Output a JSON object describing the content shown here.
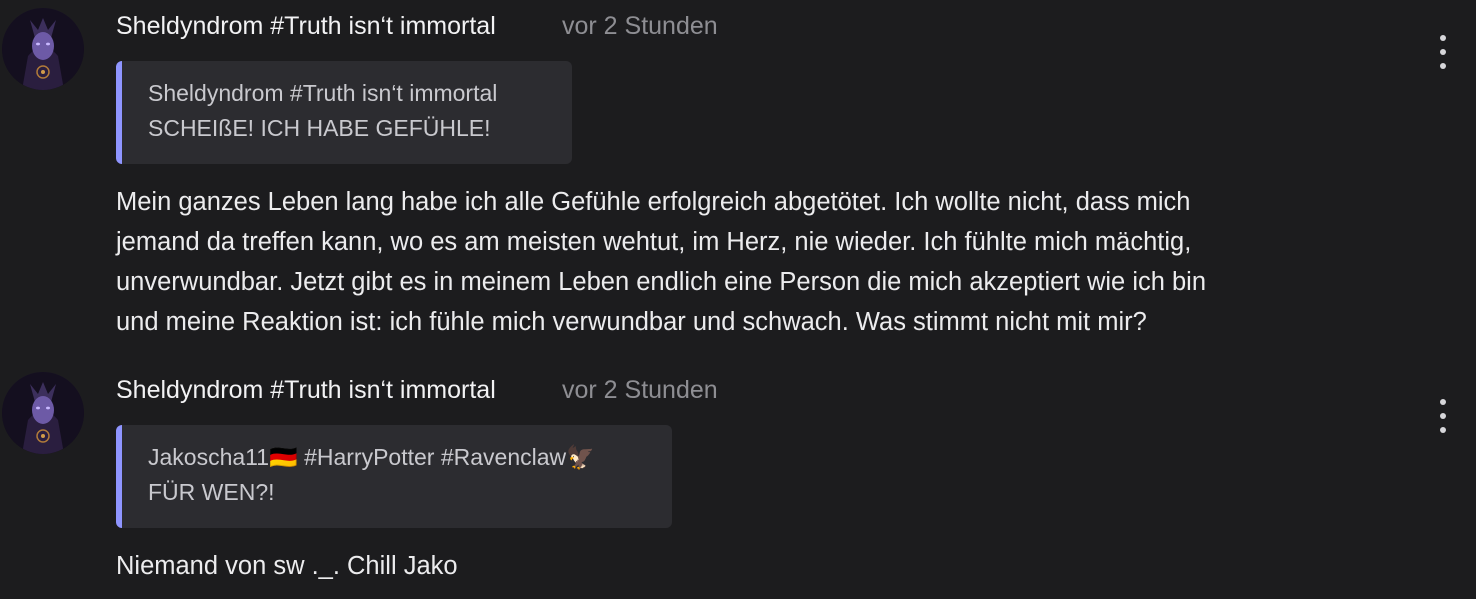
{
  "posts": [
    {
      "author": "Sheldyndrom #Truth isn‘t immortal",
      "time": "vor 2 Stunden",
      "quote": {
        "author": "Sheldyndrom #Truth isn‘t immortal",
        "text": "SCHEIßE! ICH HABE GEFÜHLE!"
      },
      "body": "Mein ganzes Leben lang habe ich alle Gefühle erfolgreich abgetötet. Ich wollte nicht, dass mich\njemand da treffen kann, wo es am meisten wehtut, im Herz, nie wieder. Ich fühlte mich mächtig,\nunverwundbar. Jetzt gibt es in meinem Leben endlich eine Person die mich akzeptiert wie ich bin\nund meine Reaktion ist: ich fühle mich verwundbar und schwach. Was stimmt nicht mit mir?"
    },
    {
      "author": "Sheldyndrom #Truth isn‘t immortal",
      "time": "vor 2 Stunden",
      "quote": {
        "author": "Jakoscha11🇩🇪 #HarryPotter #Ravenclaw🦅",
        "text": "FÜR WEN?!"
      },
      "body": "Niemand von sw ._. Chill Jako"
    }
  ],
  "colors": {
    "background": "#1c1c1e",
    "quote_background": "#2c2c30",
    "quote_accent": "#8f95ff",
    "muted_text": "#8e8e93"
  },
  "icons": {
    "more": "more-vertical-icon",
    "avatar": "avatar-image"
  }
}
